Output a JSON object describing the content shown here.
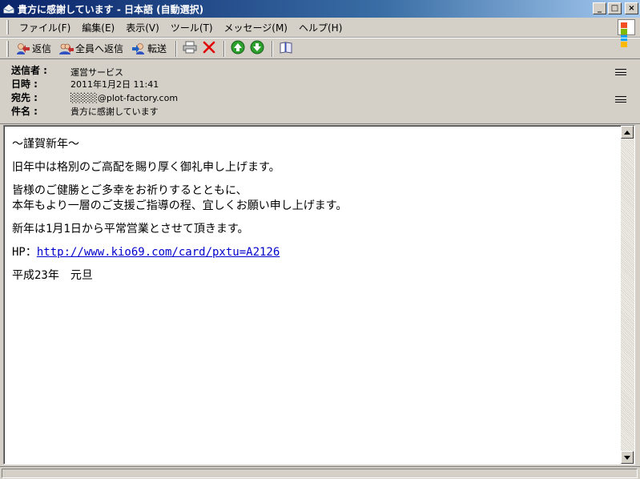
{
  "window": {
    "title": "貴方に感謝しています - 日本語 (自動選択)",
    "minimize": "_",
    "maximize": "□",
    "close": "×"
  },
  "menu": {
    "items": [
      "ファイル(F)",
      "編集(E)",
      "表示(V)",
      "ツール(T)",
      "メッセージ(M)",
      "ヘルプ(H)"
    ]
  },
  "toolbar": {
    "reply": "返信",
    "reply_all": "全員へ返信",
    "forward": "転送"
  },
  "header": {
    "from_label": "送信者 :",
    "from_value": "運営サービス",
    "date_label": "日時 :",
    "date_value": "2011年1月2日 11:41",
    "to_label": "宛先 :",
    "to_value": "@plot-factory.com",
    "subject_label": "件名 :",
    "subject_value": "貴方に感謝しています"
  },
  "body": {
    "line1": "～謹賀新年～",
    "line2": "旧年中は格別のご高配を賜り厚く御礼申し上げます。",
    "line3": "皆様のご健勝とご多幸をお祈りするとともに、",
    "line4": "本年もより一層のご支援ご指導の程、宜しくお願い申し上げます。",
    "line5": "新年は1月1日から平常営業とさせて頂きます。",
    "hp_label": "HP：",
    "hp_url": "http://www.kio69.com/card/pxtu=A2126",
    "line7": "平成23年　元旦"
  },
  "colors": {
    "title_gradient_start": "#0a246a",
    "title_gradient_end": "#a6caf0",
    "link": "#0000cc",
    "delete_red": "#e00000",
    "nav_green": "#2ea02e"
  }
}
